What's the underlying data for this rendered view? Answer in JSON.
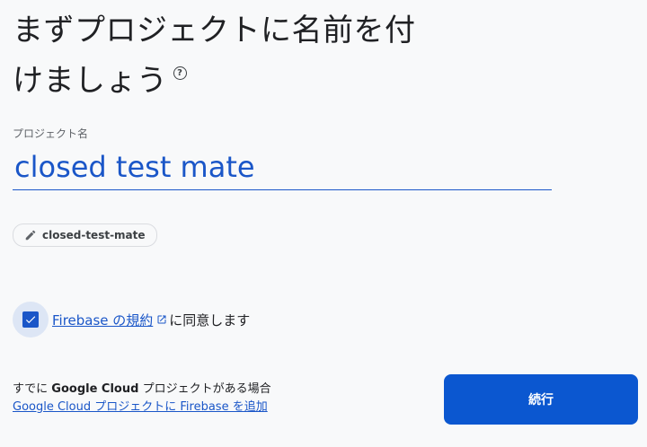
{
  "header": {
    "title_line1": "まずプロジェクトに名前を付",
    "title_line2": "けましょう",
    "help_icon": "help-circle-icon",
    "help_glyph": "?"
  },
  "project_name": {
    "label": "プロジェクト名",
    "value": "closed test mate"
  },
  "project_id_chip": {
    "icon": "pencil-icon",
    "label": "closed-test-mate"
  },
  "terms": {
    "checked": true,
    "link_text": "Firebase の規約",
    "link_icon": "open-in-new-icon",
    "suffix": "に同意します"
  },
  "existing_project": {
    "prefix": "すでに",
    "bold": "Google Cloud",
    "suffix": "プロジェクトがある場合",
    "link_text": "Google Cloud プロジェクトに Firebase を追加"
  },
  "continue_button": {
    "label": "続行"
  },
  "colors": {
    "accent": "#1a56c8",
    "button": "#0b57d0",
    "background": "#f8f9fa"
  }
}
